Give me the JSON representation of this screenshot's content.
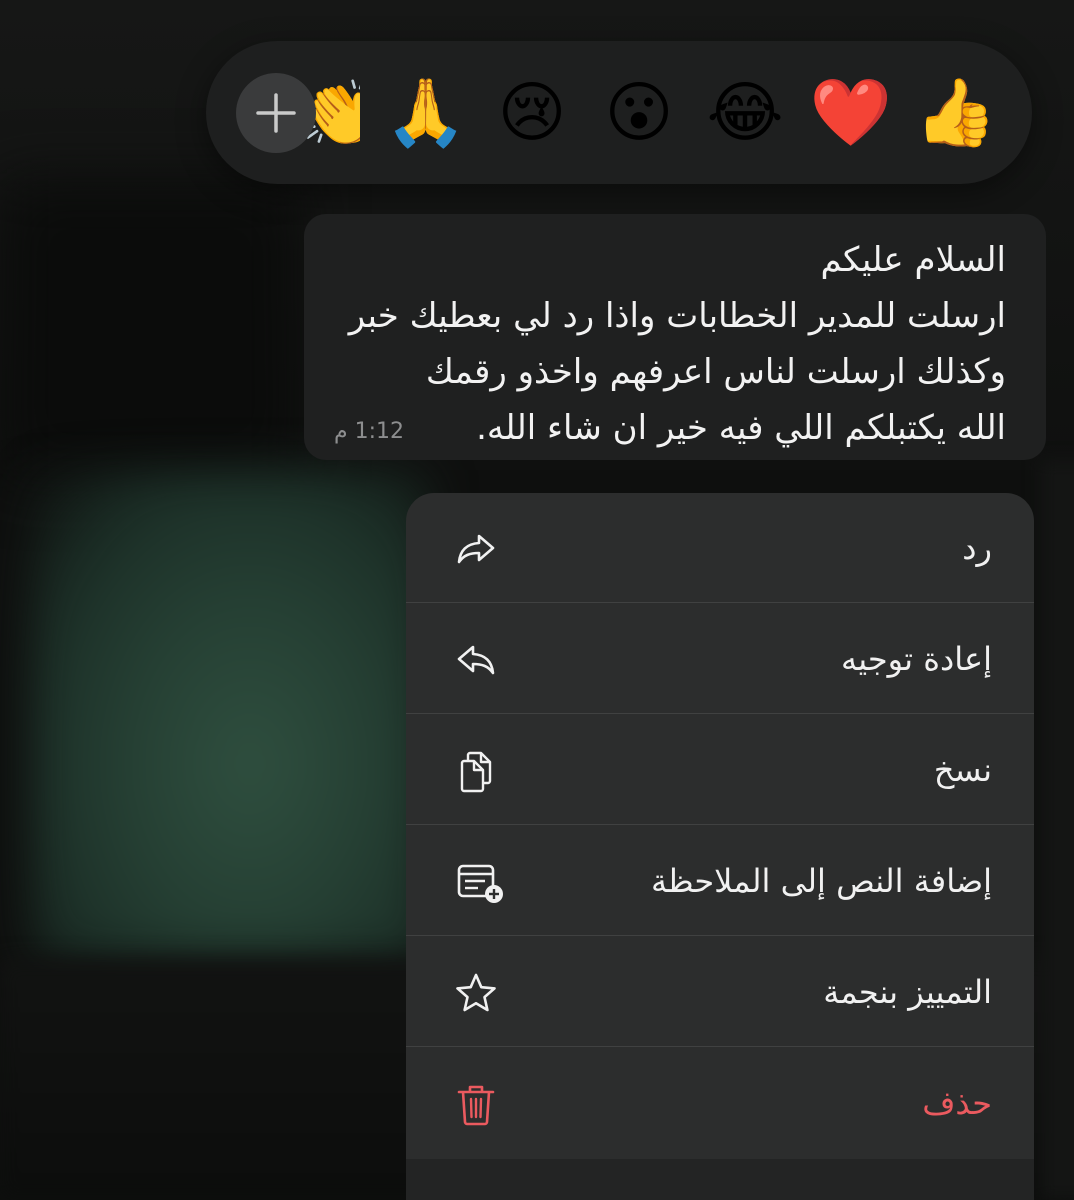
{
  "reactions": {
    "emojis": [
      "👍",
      "❤️",
      "😂",
      "😮",
      "😢",
      "🙏",
      "👏"
    ],
    "more_label": "+"
  },
  "message": {
    "lines": [
      "السلام عليكم",
      "ارسلت للمدير الخطابات واذا رد لي بعطيك خبر",
      "وكذلك ارسلت لناس اعرفهم واخذو رقمك",
      "الله يكتبلكم اللي فيه خير ان شاء الله."
    ],
    "time": "1:12 م"
  },
  "menu": {
    "items": [
      {
        "label": "رد",
        "icon": "reply-icon"
      },
      {
        "label": "إعادة توجيه",
        "icon": "forward-icon"
      },
      {
        "label": "نسخ",
        "icon": "copy-icon"
      },
      {
        "label": "إضافة النص إلى الملاحظة",
        "icon": "add-note-icon"
      },
      {
        "label": "التمييز بنجمة",
        "icon": "star-icon"
      },
      {
        "label": "حذف",
        "icon": "trash-icon"
      }
    ],
    "danger_color": "#eb5a5f"
  }
}
